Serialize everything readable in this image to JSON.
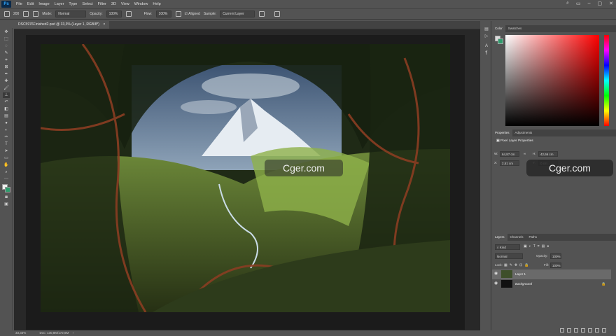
{
  "app": {
    "logo": "Ps"
  },
  "menubar": {
    "items": [
      "File",
      "Edit",
      "Image",
      "Layer",
      "Type",
      "Select",
      "Filter",
      "3D",
      "View",
      "Window",
      "Help"
    ]
  },
  "options": {
    "mode_label": "Mode:",
    "mode_value": "Normal",
    "opacity_label": "Opacity:",
    "opacity_value": "100%",
    "flow_label": "Flow:",
    "flow_value": "100%",
    "aligned_label": "Aligned",
    "sample_label": "Sample:",
    "sample_value": "Current Layer",
    "brush_size": "200"
  },
  "document": {
    "tab_title": "DSC5976Finished2.psd @ 33,3% (Layer 1, RGB/8*)"
  },
  "status": {
    "zoom": "33,33%",
    "doc_info": "Doc: 130,8M/172,6M"
  },
  "watermark": "Cger.com",
  "color_panel": {
    "tabs": [
      "Color",
      "Swatches"
    ]
  },
  "properties": {
    "tabs": [
      "Properties",
      "Adjustments"
    ],
    "title": "Pixel Layer Properties",
    "w_label": "W:",
    "w_value": "64,87 cm",
    "h_label": "H:",
    "h_value": "42,66 cm",
    "x_label": "X:",
    "x_value": "2,51 cm",
    "y_label": "Y:",
    "y_value": "0 cm"
  },
  "layers": {
    "tabs": [
      "Layers",
      "Channels",
      "Paths"
    ],
    "kind": "Kind",
    "blend": "Normal",
    "opacity_label": "Opacity:",
    "opacity_value": "100%",
    "lock_label": "Lock:",
    "fill_label": "Fill:",
    "fill_value": "100%",
    "rows": [
      {
        "name": "Layer 1"
      },
      {
        "name": "Background"
      }
    ]
  },
  "colors": {
    "accent": "#31a8ff",
    "panel": "#535353",
    "canvas": "#282828"
  }
}
